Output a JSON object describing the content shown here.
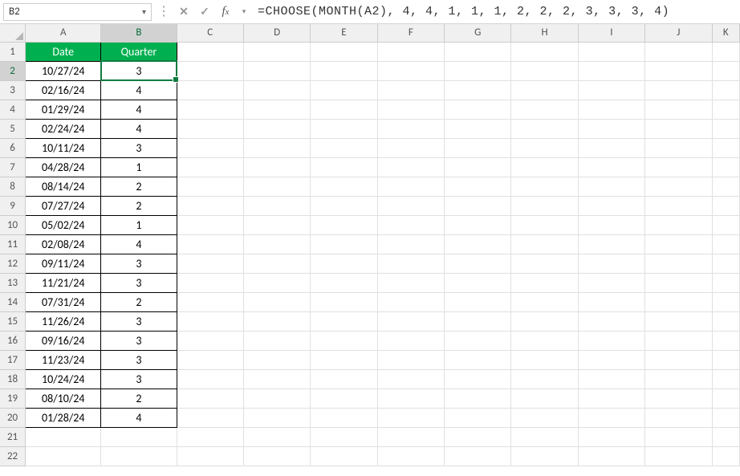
{
  "name_box": "B2",
  "formula": "=CHOOSE(MONTH(A2), 4, 4, 1, 1, 1, 2, 2, 2, 3, 3, 3, 4)",
  "columns": [
    "A",
    "B",
    "C",
    "D",
    "E",
    "F",
    "G",
    "H",
    "I",
    "J",
    "K"
  ],
  "header_row": {
    "A": "Date",
    "B": "Quarter"
  },
  "data_rows": [
    {
      "r": 2,
      "A": "10/27/24",
      "B": "3"
    },
    {
      "r": 3,
      "A": "02/16/24",
      "B": "4"
    },
    {
      "r": 4,
      "A": "01/29/24",
      "B": "4"
    },
    {
      "r": 5,
      "A": "02/24/24",
      "B": "4"
    },
    {
      "r": 6,
      "A": "10/11/24",
      "B": "3"
    },
    {
      "r": 7,
      "A": "04/28/24",
      "B": "1"
    },
    {
      "r": 8,
      "A": "08/14/24",
      "B": "2"
    },
    {
      "r": 9,
      "A": "07/27/24",
      "B": "2"
    },
    {
      "r": 10,
      "A": "05/02/24",
      "B": "1"
    },
    {
      "r": 11,
      "A": "02/08/24",
      "B": "4"
    },
    {
      "r": 12,
      "A": "09/11/24",
      "B": "3"
    },
    {
      "r": 13,
      "A": "11/21/24",
      "B": "3"
    },
    {
      "r": 14,
      "A": "07/31/24",
      "B": "2"
    },
    {
      "r": 15,
      "A": "11/26/24",
      "B": "3"
    },
    {
      "r": 16,
      "A": "09/16/24",
      "B": "3"
    },
    {
      "r": 17,
      "A": "11/23/24",
      "B": "3"
    },
    {
      "r": 18,
      "A": "10/24/24",
      "B": "3"
    },
    {
      "r": 19,
      "A": "08/10/24",
      "B": "2"
    },
    {
      "r": 20,
      "A": "01/28/24",
      "B": "4"
    }
  ],
  "empty_rows": [
    21,
    22
  ],
  "selected_cell": "B2",
  "colors": {
    "header_bg": "#00b050",
    "selection": "#107c41"
  }
}
